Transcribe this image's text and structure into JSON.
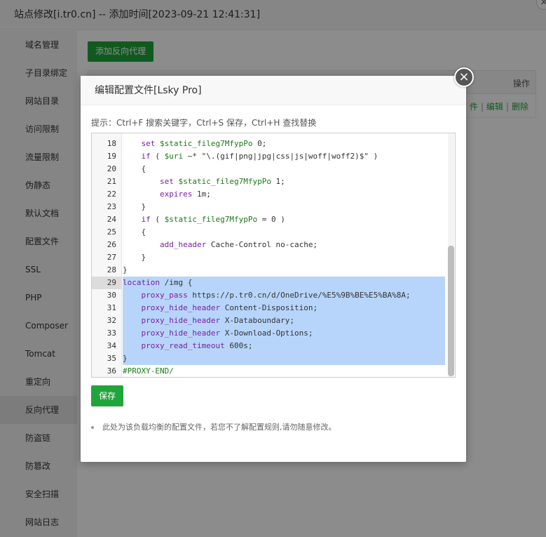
{
  "window": {
    "title": "站点修改[i.tr0.cn] -- 添加时间[2023-09-21 12:41:31]",
    "close_glyph": "×"
  },
  "sidebar": {
    "items": [
      {
        "label": "域名管理"
      },
      {
        "label": "子目录绑定"
      },
      {
        "label": "网站目录"
      },
      {
        "label": "访问限制"
      },
      {
        "label": "流量限制"
      },
      {
        "label": "伪静态"
      },
      {
        "label": "默认文档"
      },
      {
        "label": "配置文件"
      },
      {
        "label": "SSL"
      },
      {
        "label": "PHP"
      },
      {
        "label": "Composer"
      },
      {
        "label": "Tomcat"
      },
      {
        "label": "重定向"
      },
      {
        "label": "反向代理"
      },
      {
        "label": "防盗链"
      },
      {
        "label": "防篡改"
      },
      {
        "label": "安全扫描"
      },
      {
        "label": "网站日志"
      }
    ],
    "active_index": 13
  },
  "main": {
    "add_button": "添加反向代理",
    "table": {
      "op_header": "操作",
      "links": [
        "件",
        "编辑",
        "删除"
      ],
      "separator": "|"
    }
  },
  "modal": {
    "title": "编辑配置文件[Lsky Pro]",
    "close_glyph": "×",
    "tip": "提示：Ctrl+F 搜索关键字，Ctrl+S 保存，Ctrl+H 查找替换",
    "save_button": "保存",
    "note": "此处为该负载均衡的配置文件，若您不了解配置规则,请勿随意修改。"
  },
  "editor": {
    "lines": [
      {
        "n": "18",
        "t": "    set $static_fileg7MfypPo 0;"
      },
      {
        "n": "19",
        "t": "    if ( $uri ~* \"\\.(gif|png|jpg|css|js|woff|woff2)$\" )"
      },
      {
        "n": "20",
        "t": "    {"
      },
      {
        "n": "21",
        "t": "        set $static_fileg7MfypPo 1;"
      },
      {
        "n": "22",
        "t": "        expires 1m;"
      },
      {
        "n": "23",
        "t": "    }"
      },
      {
        "n": "24",
        "t": "    if ( $static_fileg7MfypPo = 0 )"
      },
      {
        "n": "25",
        "t": "    {"
      },
      {
        "n": "26",
        "t": "        add_header Cache-Control no-cache;"
      },
      {
        "n": "27",
        "t": "    }"
      },
      {
        "n": "28",
        "t": "}"
      },
      {
        "n": "29",
        "t": "location /img {"
      },
      {
        "n": "30",
        "t": "    proxy_pass https://p.tr0.cn/d/OneDrive/%E5%9B%BE%E5%BA%8A;"
      },
      {
        "n": "31",
        "t": "    proxy_hide_header Content-Disposition;"
      },
      {
        "n": "32",
        "t": "    proxy_hide_header X-Databoundary;"
      },
      {
        "n": "33",
        "t": "    proxy_hide_header X-Download-Options;"
      },
      {
        "n": "34",
        "t": "    proxy_read_timeout 600s;"
      },
      {
        "n": "35",
        "t": "}"
      },
      {
        "n": "36",
        "t": "#PROXY-END/"
      }
    ],
    "selected_from": 29,
    "selected_to": 35,
    "cursor_line": 29
  },
  "colors": {
    "accent": "#20a53a",
    "selection": "#b7d5fb",
    "keyword": "#7a1fa2",
    "variable": "#1a7a1a"
  }
}
